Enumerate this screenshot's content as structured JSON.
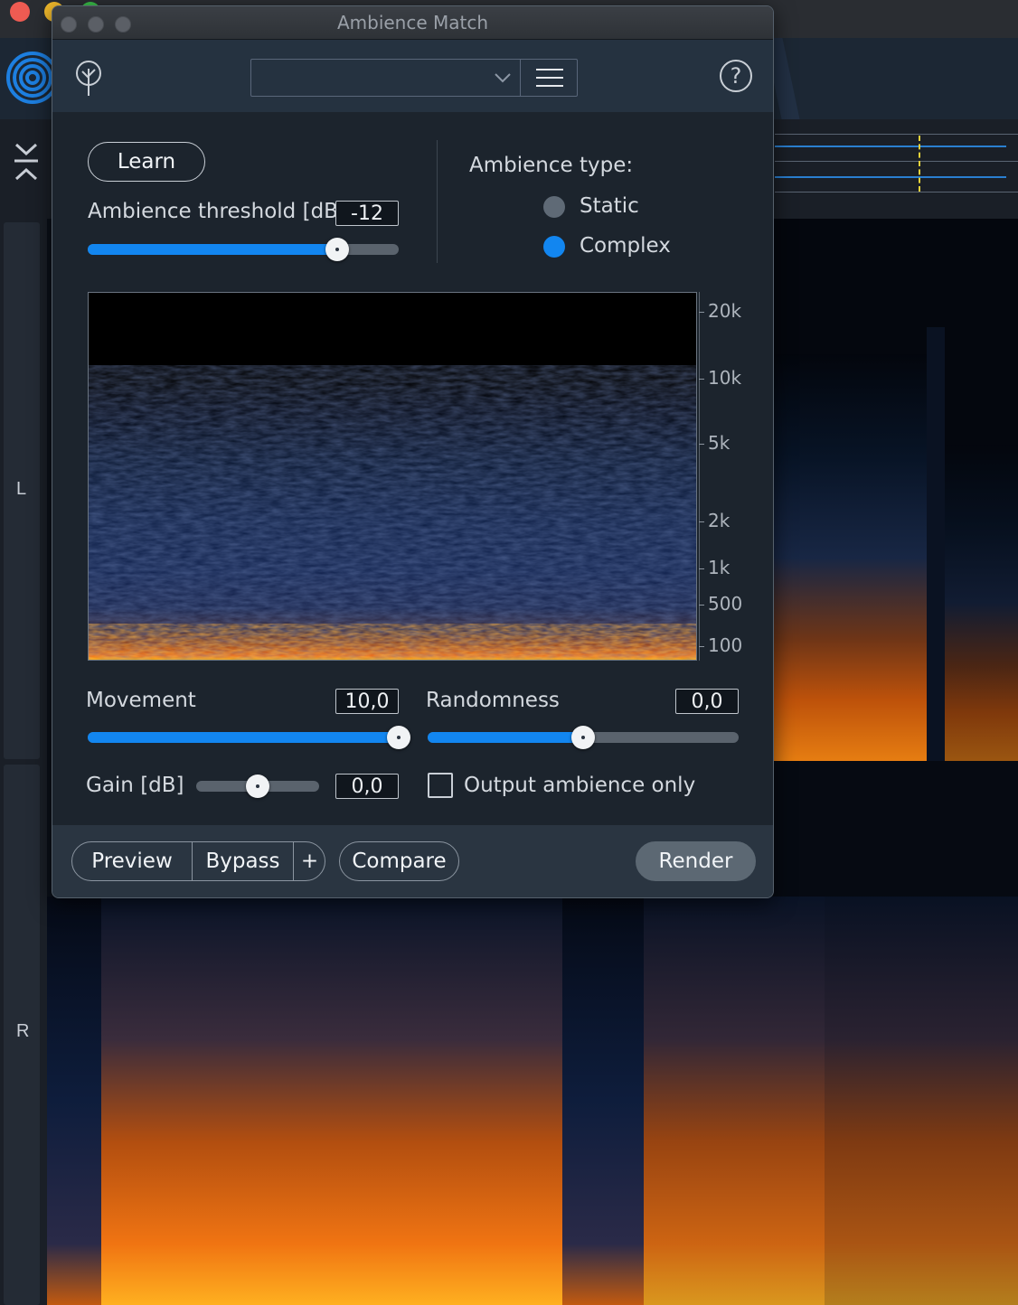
{
  "window": {
    "title": "Ambience Match"
  },
  "host": {
    "channel_left": "L",
    "channel_right": "R"
  },
  "header": {
    "preset_value": "",
    "help_label": "?"
  },
  "learn": {
    "button_label": "Learn"
  },
  "threshold": {
    "label": "Ambience threshold [dB]",
    "value": "-12",
    "level_fraction": 0.8
  },
  "ambience_type": {
    "label": "Ambience type:",
    "options": [
      "Static",
      "Complex"
    ],
    "selected": "Complex"
  },
  "spectrum_axis": {
    "ticks": [
      "20k",
      "10k",
      "5k",
      "2k",
      "1k",
      "500",
      "100"
    ]
  },
  "movement": {
    "label": "Movement",
    "value": "10,0",
    "level_fraction": 1.0
  },
  "randomness": {
    "label": "Randomness",
    "value": "0,0",
    "level_fraction": 0.5
  },
  "gain": {
    "label": "Gain [dB]",
    "value": "0,0",
    "level_fraction": 0.5
  },
  "output_only": {
    "label": "Output ambience only",
    "checked": false
  },
  "footer": {
    "preview_label": "Preview",
    "bypass_label": "Bypass",
    "plus_label": "+",
    "compare_label": "Compare",
    "render_label": "Render"
  },
  "colors": {
    "accent": "#1286f0",
    "spectrum_hot": "#ff6e0a",
    "window_bg": "#1c242d"
  }
}
